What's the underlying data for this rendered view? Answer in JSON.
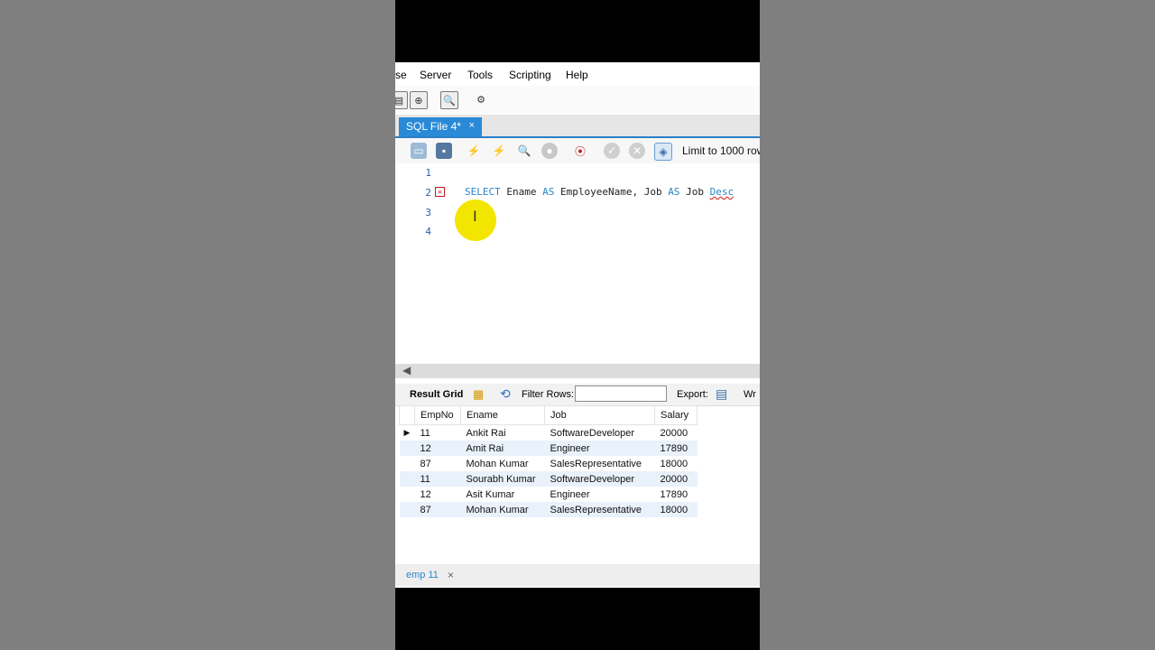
{
  "menu": [
    "se",
    "Server",
    "Tools",
    "Scripting",
    "Help"
  ],
  "tab": {
    "label": "SQL File 4*",
    "close": "×"
  },
  "toolbar": {
    "limit_label": "Limit to 1000 row"
  },
  "editor": {
    "line_numbers": [
      "1",
      "2",
      "3",
      "4"
    ],
    "code": {
      "kw_select": "SELECT",
      "part1": " Ename ",
      "kw_as1": "AS",
      "part2": " EmployeeName, Job ",
      "kw_as2": "AS",
      "part3": " Job ",
      "err_word": "Desc"
    },
    "cursor_glyph": "I"
  },
  "result_bar": {
    "result_grid": "Result Grid",
    "filter_label": "Filter Rows:",
    "filter_value": "",
    "export_label": "Export:",
    "wrap_label": "Wr"
  },
  "grid": {
    "columns": [
      "EmpNo",
      "Ename",
      "Job",
      "Salary"
    ],
    "rows": [
      [
        "11",
        "Ankit Rai",
        "SoftwareDeveloper",
        "20000"
      ],
      [
        "12",
        "Amit Rai",
        "Engineer",
        "17890"
      ],
      [
        "87",
        "Mohan Kumar",
        "SalesRepresentative",
        "18000"
      ],
      [
        "11",
        "Sourabh Kumar",
        "SoftwareDeveloper",
        "20000"
      ],
      [
        "12",
        "Asit Kumar",
        "Engineer",
        "17890"
      ],
      [
        "87",
        "Mohan Kumar",
        "SalesRepresentative",
        "18000"
      ]
    ]
  },
  "bottom_tab": {
    "label": "emp 11",
    "close": "×"
  },
  "colors": {
    "accent": "#2a8ad8",
    "keyword": "#2a86c8",
    "highlight": "#f2e600",
    "row_alt": "#e9f1fb"
  }
}
